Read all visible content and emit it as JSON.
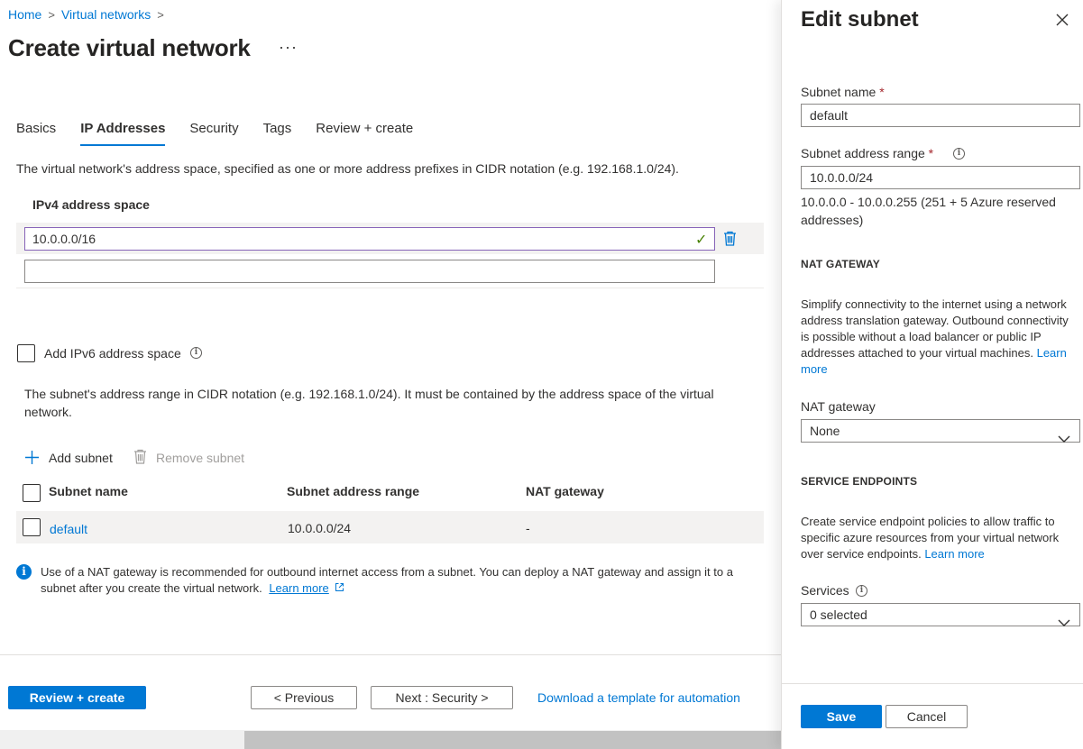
{
  "breadcrumb": {
    "home": "Home",
    "virtual_networks": "Virtual networks",
    "separator": ">"
  },
  "page": {
    "title": "Create virtual network",
    "more": "···"
  },
  "tabs": [
    {
      "label": "Basics",
      "active": false
    },
    {
      "label": "IP Addresses",
      "active": true
    },
    {
      "label": "Security",
      "active": false
    },
    {
      "label": "Tags",
      "active": false
    },
    {
      "label": "Review + create",
      "active": false
    }
  ],
  "address_space": {
    "description": "The virtual network's address space, specified as one or more address prefixes in CIDR notation (e.g. 192.168.1.0/24).",
    "heading": "IPv4 address space",
    "entries": [
      "10.0.0.0/16",
      ""
    ],
    "add_ipv6_label": "Add IPv6 address space"
  },
  "subnets": {
    "description": "The subnet's address range in CIDR notation (e.g. 192.168.1.0/24). It must be contained by the address space of the virtual network.",
    "add_label": "Add subnet",
    "remove_label": "Remove subnet",
    "columns": [
      "Subnet name",
      "Subnet address range",
      "NAT gateway"
    ],
    "rows": [
      {
        "name": "default",
        "range": "10.0.0.0/24",
        "nat": "-"
      }
    ]
  },
  "info_banner": {
    "text": "Use of a NAT gateway is recommended for outbound internet access from a subnet. You can deploy a NAT gateway and assign it to a subnet after you create the virtual network.",
    "link": "Learn more"
  },
  "footer": {
    "review_create": "Review + create",
    "previous": "< Previous",
    "next": "Next : Security >",
    "download": "Download a template for automation"
  },
  "panel": {
    "title": "Edit subnet",
    "subnet_name_label": "Subnet name",
    "required_mark": "*",
    "subnet_name_value": "default",
    "range_label": "Subnet address range",
    "range_value": "10.0.0.0/24",
    "range_hint": "10.0.0.0 - 10.0.0.255 (251 + 5 Azure reserved addresses)",
    "nat_section": "NAT GATEWAY",
    "nat_description": "Simplify connectivity to the internet using a network address translation gateway. Outbound connectivity is possible without a load balancer or public IP addresses attached to your virtual machines.",
    "nat_learn_more": "Learn more",
    "nat_label": "NAT gateway",
    "nat_value": "None",
    "endpoints_section": "SERVICE ENDPOINTS",
    "endpoints_description": "Create service endpoint policies to allow traffic to specific azure resources from your virtual network over service endpoints.",
    "endpoints_learn_more": "Learn more",
    "services_label": "Services",
    "services_value": "0 selected",
    "save": "Save",
    "cancel": "Cancel"
  },
  "colors": {
    "accent": "#0078d4",
    "required": "#a4262c",
    "valid": "#498205",
    "focus_border": "#8764b8"
  }
}
